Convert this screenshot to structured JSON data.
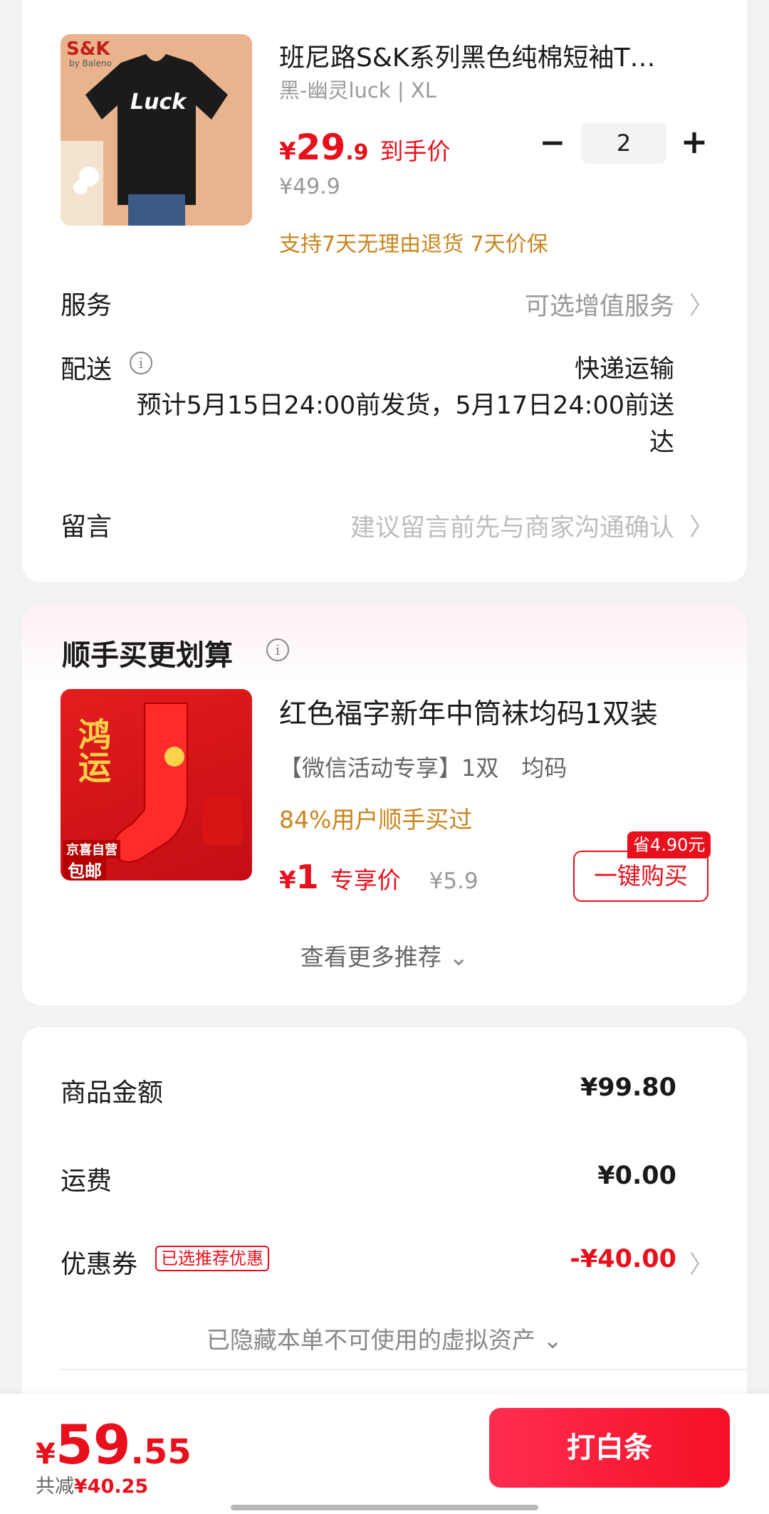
{
  "product": {
    "title": "班尼路S&K系列黑色纯棉短袖T…",
    "spec": "黑-幽灵luck | XL",
    "price_yen": "¥",
    "price_int": "29",
    "price_dec": ".9",
    "price_tag": "到手价",
    "orig_price": "¥49.9",
    "guarantee": "支持7天无理由退货 7天价保",
    "quantity": "2",
    "minus": "−",
    "plus": "+",
    "image_brand": "S&K",
    "image_brand_sub": "by Baleno",
    "image_print": "Luck"
  },
  "service": {
    "label": "服务",
    "value": "可选增值服务"
  },
  "delivery": {
    "label": "配送",
    "method": "快递运输",
    "estimate": "预计5月15日24:00前发货，5月17日24:00前送达"
  },
  "message": {
    "label": "留言",
    "placeholder": "建议留言前先与商家沟通确认"
  },
  "addon": {
    "section_title": "顺手买更划算",
    "title": "红色福字新年中筒袜均码1双装",
    "spec": "【微信活动专享】1双　均码",
    "percent": "84%用户顺手买过",
    "price_yen": "¥",
    "price": "1",
    "price_tag": "专享价",
    "orig_price": "¥5.9",
    "save_badge": "省4.90元",
    "buy_button": "一键购买",
    "image_text": "鸿运",
    "image_badge_top": "京喜自营",
    "image_badge": "包邮",
    "more": "查看更多推荐"
  },
  "summary": {
    "goods_label": "商品金额",
    "goods_value": "¥99.80",
    "shipping_label": "运费",
    "shipping_value": "¥0.00",
    "coupon_label": "优惠券",
    "coupon_tag": "已选推荐优惠",
    "coupon_value": "-¥40.00",
    "hidden_assets": "已隐藏本单不可使用的虚拟资产"
  },
  "footer": {
    "total_yen": "¥",
    "total_int": "59",
    "total_dec": ".55",
    "reduce_label": "共减",
    "reduce_value": "¥40.25",
    "pay_button": "打白条"
  },
  "colors": {
    "accent": "#e8101c",
    "orange": "#c8851e"
  },
  "icons": [
    "info-icon",
    "chevron-right-icon",
    "chevron-down-icon",
    "minus-icon",
    "plus-icon"
  ]
}
